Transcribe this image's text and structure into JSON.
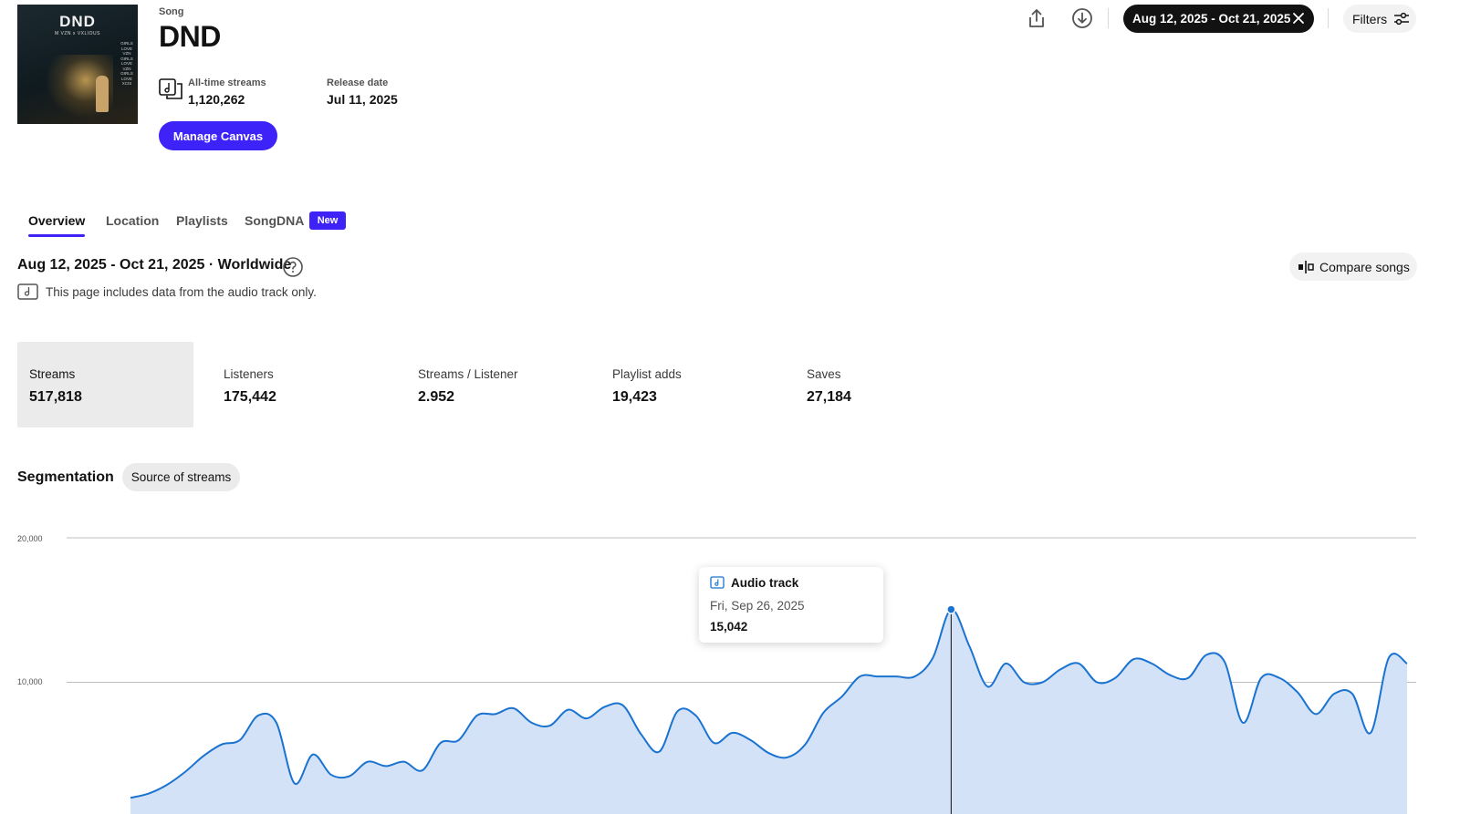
{
  "song": {
    "kicker": "Song",
    "title": "DND",
    "cover": {
      "title": "DND",
      "subtitle": "M VZN x VXLIOUS",
      "tracklist": [
        "GIRLS",
        "LOVE",
        "VZN",
        "GIRLS",
        "LOVE",
        "VZN",
        "GIRLS",
        "LOVE",
        "XCIS"
      ]
    },
    "all_time_streams_label": "All-time streams",
    "all_time_streams_value": "1,120,262",
    "release_date_label": "Release date",
    "release_date_value": "Jul 11, 2025",
    "manage_canvas_label": "Manage Canvas"
  },
  "toolbar": {
    "share_icon": "share-icon",
    "download_icon": "download-icon",
    "date_range": "Aug 12, 2025 - Oct 21, 2025",
    "filters_label": "Filters"
  },
  "tabs": [
    {
      "label": "Overview",
      "active": true
    },
    {
      "label": "Location",
      "active": false
    },
    {
      "label": "Playlists",
      "active": false
    },
    {
      "label": "SongDNA",
      "active": false,
      "badge": "New"
    }
  ],
  "summary": {
    "heading": "Aug 12, 2025 - Oct 21, 2025 · Worldwide",
    "note": "This page includes data from the audio track only.",
    "compare_label": "Compare songs"
  },
  "metrics": [
    {
      "label": "Streams",
      "value": "517,818",
      "active": true
    },
    {
      "label": "Listeners",
      "value": "175,442",
      "active": false
    },
    {
      "label": "Streams / Listener",
      "value": "2.952",
      "active": false
    },
    {
      "label": "Playlist adds",
      "value": "19,423",
      "active": false
    },
    {
      "label": "Saves",
      "value": "27,184",
      "active": false
    }
  ],
  "segmentation": {
    "label": "Segmentation",
    "chip": "Source of streams"
  },
  "tooltip": {
    "series": "Audio track",
    "date": "Fri, Sep 26, 2025",
    "value": "15,042"
  },
  "colors": {
    "accent": "#3d23f7",
    "line": "#1a73d0",
    "fill": "#d3e2f7"
  },
  "chart_data": {
    "type": "area",
    "y_ticks": [
      "20,000",
      "10,000"
    ],
    "ylim": [
      0,
      20000
    ],
    "highlight_index": 45,
    "series": [
      {
        "name": "Audio track",
        "values": [
          2000,
          2300,
          2900,
          3800,
          4900,
          5700,
          6000,
          7700,
          7200,
          3000,
          5000,
          3600,
          3500,
          4500,
          4200,
          4500,
          3900,
          5800,
          6000,
          7700,
          7800,
          8200,
          7200,
          7000,
          8100,
          7500,
          8300,
          8400,
          6400,
          5200,
          8000,
          7700,
          5800,
          6500,
          6000,
          5100,
          4800,
          5700,
          7900,
          9000,
          10400,
          10400,
          10400,
          10400,
          11700,
          15042,
          12500,
          9700,
          11300,
          10000,
          10000,
          10900,
          11300,
          10000,
          10300,
          11600,
          11300,
          10500,
          10300,
          11900,
          11400,
          7200,
          10300,
          10300,
          9300,
          7800,
          9200,
          9200,
          6500,
          11700,
          11300
        ]
      }
    ]
  }
}
